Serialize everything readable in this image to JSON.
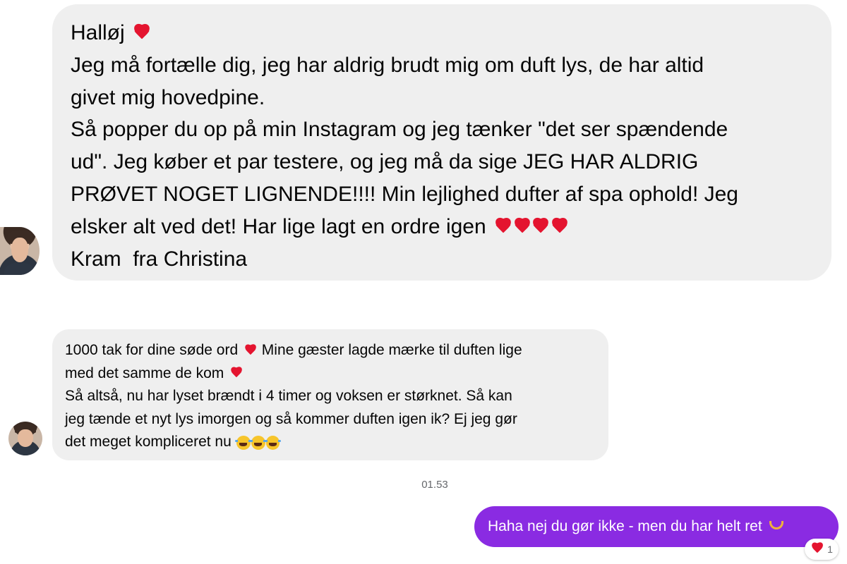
{
  "thread": {
    "messages": [
      {
        "sender": "incoming",
        "lines": [
          "Halløj",
          "Jeg må fortælle dig, jeg har aldrig brudt mig om duft lys, de har altid",
          "givet mig hovedpine.",
          "Så popper du op på min Instagram og jeg tænker \"det ser spændende",
          "ud\". Jeg køber et par testere, og jeg må da sige JEG HAR ALDRIG",
          "PRØVET NOGET LIGNENDE!!!! Min lejlighed dufter af spa ophold! Jeg",
          "elsker alt ved det! Har lige lagt en ordre igen",
          "Kram  fra Christina"
        ]
      },
      {
        "sender": "incoming",
        "lines": [
          "1000 tak for dine søde ord",
          "Mine gæster lagde mærke til duften lige",
          "med det samme de kom",
          "Så altså, nu har lyset brændt i 4 timer og voksen er størknet. Så kan",
          "jeg tænde et nyt lys imorgen og så kommer duften igen ik? Ej jeg gør",
          "det meget kompliceret nu"
        ]
      }
    ],
    "timestamp": "01.53",
    "outgoing": {
      "text": "Haha nej du gør ikke - men du har helt ret",
      "reaction_count": "1",
      "reaction_icon": "red-heart-icon"
    }
  },
  "icons": {
    "heart": "red-heart-icon",
    "laugh": "tears-of-joy-icon",
    "handheart": "heart-hands-icon"
  },
  "colors": {
    "incoming_bubble": "#efefef",
    "outgoing_bubble": "#8a2be2",
    "timestamp": "#65676b",
    "heart": "#e4142f"
  }
}
